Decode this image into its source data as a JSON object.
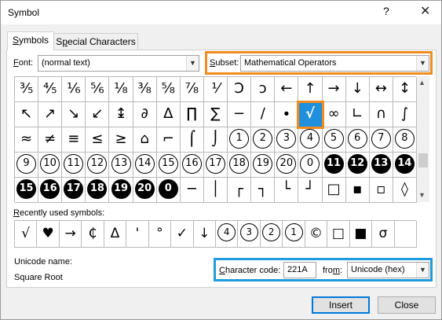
{
  "window": {
    "title": "Symbol",
    "help_glyph": "?",
    "close_glyph": "✕"
  },
  "tabs": [
    {
      "label": "Symbols",
      "mnemonic": "S",
      "rest": "ymbols"
    },
    {
      "label": "Special Characters",
      "pre": "S",
      "mnemonic": "p",
      "rest": "ecial Characters"
    }
  ],
  "font": {
    "label_mn": "F",
    "label_rest": "ont:",
    "value": "(normal text)"
  },
  "subset": {
    "label_mn": "S",
    "label_rest": "ubset:",
    "value": "Mathematical Operators"
  },
  "grid_rows": [
    [
      {
        "t": "⅗"
      },
      {
        "t": "⅘"
      },
      {
        "t": "⅙"
      },
      {
        "t": "⅚"
      },
      {
        "t": "⅛"
      },
      {
        "t": "⅜"
      },
      {
        "t": "⅝"
      },
      {
        "t": "⅞"
      },
      {
        "t": "⅟"
      },
      {
        "t": "Ↄ"
      },
      {
        "t": "ↄ"
      },
      {
        "t": "←"
      },
      {
        "t": "↑"
      },
      {
        "t": "→"
      },
      {
        "t": "↓"
      },
      {
        "t": "↔"
      },
      {
        "t": "↕"
      }
    ],
    [
      {
        "t": "↖"
      },
      {
        "t": "↗"
      },
      {
        "t": "↘"
      },
      {
        "t": "↙"
      },
      {
        "t": "↨"
      },
      {
        "t": "∂"
      },
      {
        "t": "∆"
      },
      {
        "t": "∏"
      },
      {
        "t": "∑"
      },
      {
        "t": "−"
      },
      {
        "t": "∕"
      },
      {
        "t": "∙"
      },
      {
        "t": "√",
        "sel": true
      },
      {
        "t": "∞"
      },
      {
        "t": "∟"
      },
      {
        "t": "∩"
      },
      {
        "t": "∫"
      }
    ],
    [
      {
        "t": "≈"
      },
      {
        "t": "≠"
      },
      {
        "t": "≡"
      },
      {
        "t": "≤"
      },
      {
        "t": "≥"
      },
      {
        "t": "⌂"
      },
      {
        "t": "⌐"
      },
      {
        "t": "⌠"
      },
      {
        "t": "⌡"
      },
      {
        "t": "1",
        "c": 1
      },
      {
        "t": "2",
        "c": 1
      },
      {
        "t": "3",
        "c": 1
      },
      {
        "t": "4",
        "c": 1
      },
      {
        "t": "5",
        "c": 1
      },
      {
        "t": "6",
        "c": 1
      },
      {
        "t": "7",
        "c": 1
      },
      {
        "t": "8",
        "c": 1
      }
    ],
    [
      {
        "t": "9",
        "c": 1
      },
      {
        "t": "10",
        "c": 1
      },
      {
        "t": "11",
        "c": 1
      },
      {
        "t": "12",
        "c": 1
      },
      {
        "t": "13",
        "c": 1
      },
      {
        "t": "14",
        "c": 1
      },
      {
        "t": "15",
        "c": 1
      },
      {
        "t": "16",
        "c": 1
      },
      {
        "t": "17",
        "c": 1
      },
      {
        "t": "18",
        "c": 1
      },
      {
        "t": "19",
        "c": 1
      },
      {
        "t": "20",
        "c": 1
      },
      {
        "t": "0",
        "c": 1
      },
      {
        "t": "11",
        "c": 2
      },
      {
        "t": "12",
        "c": 2
      },
      {
        "t": "13",
        "c": 2
      },
      {
        "t": "14",
        "c": 2
      }
    ],
    [
      {
        "t": "15",
        "c": 2
      },
      {
        "t": "16",
        "c": 2
      },
      {
        "t": "17",
        "c": 2
      },
      {
        "t": "18",
        "c": 2
      },
      {
        "t": "19",
        "c": 2
      },
      {
        "t": "20",
        "c": 2
      },
      {
        "t": "0",
        "c": 2
      },
      {
        "t": "─"
      },
      {
        "t": "│"
      },
      {
        "t": "┌"
      },
      {
        "t": "┐"
      },
      {
        "t": "└"
      },
      {
        "t": "┘"
      },
      {
        "t": "□"
      },
      {
        "t": "▪"
      },
      {
        "t": "▫"
      },
      {
        "t": "◊"
      }
    ]
  ],
  "recent": {
    "label": "Recently used symbols:",
    "label_mn": "R",
    "label_rest": "ecently used symbols:",
    "items": [
      {
        "t": "√"
      },
      {
        "t": "♥"
      },
      {
        "t": "→"
      },
      {
        "t": "₵"
      },
      {
        "t": "Δ"
      },
      {
        "t": "'"
      },
      {
        "t": "°"
      },
      {
        "t": "✓"
      },
      {
        "t": "↓"
      },
      {
        "t": "4",
        "c": 1
      },
      {
        "t": "3",
        "c": 1
      },
      {
        "t": "2",
        "c": 1
      },
      {
        "t": "1",
        "c": 1
      },
      {
        "t": "©"
      },
      {
        "t": "□"
      },
      {
        "t": "■"
      },
      {
        "t": "σ"
      },
      {
        "t": ""
      }
    ]
  },
  "unicode": {
    "label": "Unicode name:",
    "value": "Square Root"
  },
  "charcode": {
    "label_mn": "C",
    "label_rest": "haracter code:",
    "value": "221A"
  },
  "from": {
    "label_pre": "fro",
    "label_mn": "m",
    "label_rest": ":",
    "value": "Unicode (hex)"
  },
  "buttons": {
    "insert": "Insert",
    "close": "Close"
  },
  "colors": {
    "selection": "#1f8fde",
    "orange_highlight": "#f08c1e",
    "blue_highlight": "#1f9bde"
  }
}
